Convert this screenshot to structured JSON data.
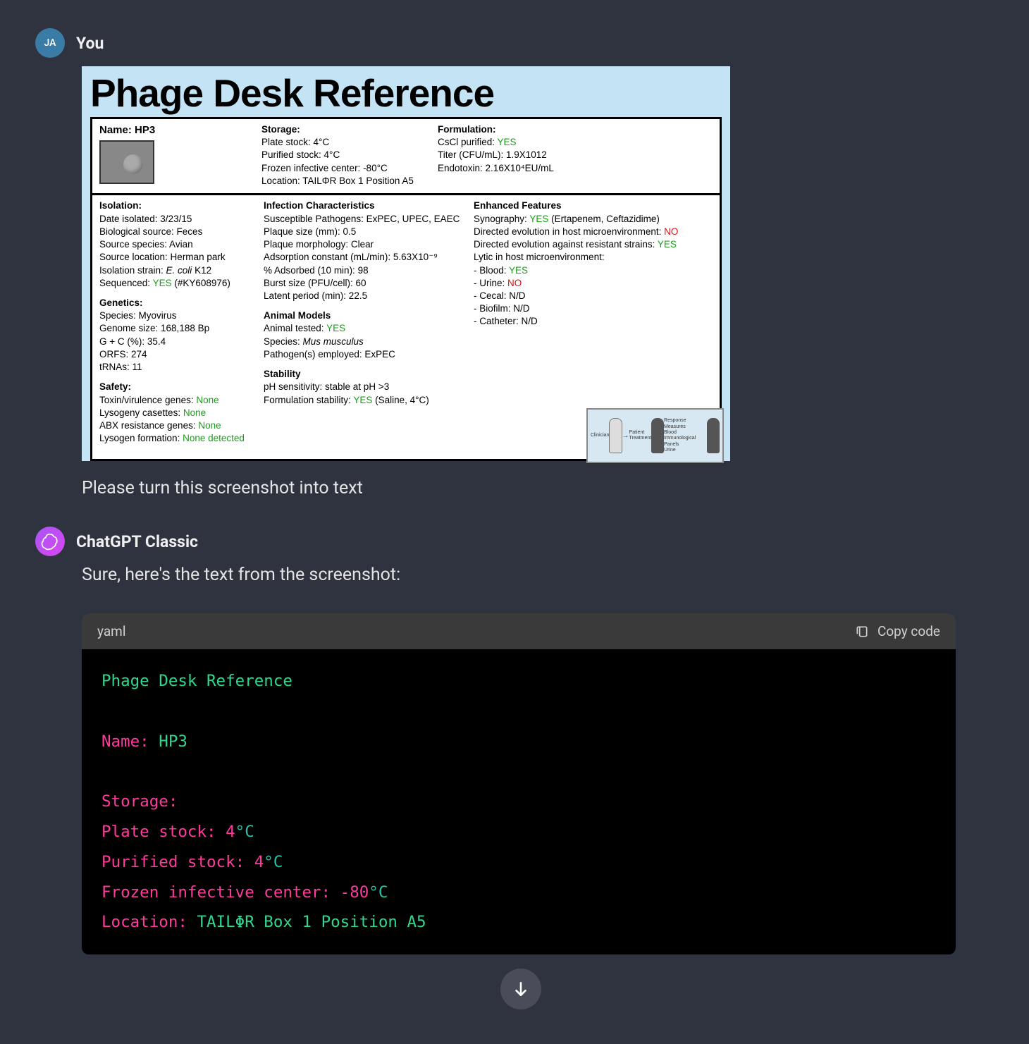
{
  "user": {
    "avatar_initials": "JA",
    "name": "You",
    "prompt": "Please turn this screenshot into text"
  },
  "bot": {
    "name": "ChatGPT Classic",
    "intro": "Sure, here's the text from the screenshot:"
  },
  "code": {
    "lang": "yaml",
    "copy_label": "Copy code",
    "lines": {
      "l1": "Phage Desk Reference",
      "l2_key": "Name:",
      "l2_val": " HP3",
      "l3": "Storage:",
      "l4_key": "Plate stock:",
      "l4_num": " 4",
      "l4_unit": "°C",
      "l5_key": "Purified stock:",
      "l5_num": " 4",
      "l5_unit": "°C",
      "l6_key": "Frozen infective center:",
      "l6_num": " -80",
      "l6_unit": "°C",
      "l7_key": "Location:",
      "l7_v1": " TAILΦR",
      "l7_v2": " Box",
      "l7_v3": " 1",
      "l7_v4": " Position",
      "l7_v5": " A5"
    }
  },
  "phage": {
    "title": "Phage Desk Reference",
    "name_label": "Name: HP3",
    "storage": {
      "title": "Storage:",
      "plate": "Plate stock: 4°C",
      "purified": "Purified stock: 4°C",
      "frozen": "Frozen infective center: -80°C",
      "location": "Location: TAILΦR Box 1 Position A5"
    },
    "formulation": {
      "title": "Formulation:",
      "cscl_label": "CsCl purified: ",
      "cscl_val": "YES",
      "titer": "Titer (CFU/mL): 1.9X1012",
      "endotoxin": "Endotoxin: 2.16X10⁴EU/mL"
    },
    "isolation": {
      "title": "Isolation:",
      "date": "Date isolated: 3/23/15",
      "bio": "Biological source: Feces",
      "species": "Source species: Avian",
      "loc": "Source location: Herman park",
      "strain_label": "Isolation strain: ",
      "strain_ital": "E. coli",
      "strain_rest": " K12",
      "seq_label": "Sequenced: ",
      "seq_val": "YES",
      "seq_rest": " (#KY608976)"
    },
    "genetics": {
      "title": "Genetics:",
      "species": "Species: Myovirus",
      "genome": "Genome size: 168,188 Bp",
      "gc": "G + C (%): 35.4",
      "orfs": "ORFS: 274",
      "trnas": "tRNAs: 11"
    },
    "safety": {
      "title": "Safety:",
      "toxin_label": "Toxin/virulence genes: ",
      "toxin_val": "None",
      "lyso_label": "Lysogeny casettes: ",
      "lyso_val": "None",
      "abx_label": "ABX resistance genes: ",
      "abx_val": "None",
      "lysof_label": "Lysogen formation: ",
      "lysof_val": "None detected"
    },
    "infection": {
      "title": "Infection Characteristics",
      "pathogens": "Susceptible Pathogens: ExPEC, UPEC, EAEC",
      "plaque_size": "Plaque size (mm): 0.5",
      "plaque_morph": "Plaque morphology: Clear",
      "adsorption": "Adsorption constant (mL/min): 5.63X10⁻⁹",
      "adsorbed": "% Adsorbed (10 min): 98",
      "burst": "Burst size (PFU/cell): 60",
      "latent": "Latent period (min): 22.5"
    },
    "animal": {
      "title": "Animal Models",
      "tested_label": "Animal tested: ",
      "tested_val": "YES",
      "species_label": "Species: ",
      "species_ital": "Mus musculus",
      "pathogens": "Pathogen(s) employed: ExPEC"
    },
    "stability": {
      "title": "Stability",
      "ph": "pH sensitivity: stable at pH >3",
      "form_label": "Formulation stability: ",
      "form_val": "YES",
      "form_rest": " (Saline, 4°C)"
    },
    "enhanced": {
      "title": "Enhanced Features",
      "syn_label": "Synography: ",
      "syn_val": "YES",
      "syn_rest": " (Ertapenem, Ceftazidime)",
      "de_host_label": "Directed evolution in host microenvironment: ",
      "de_host_val": "NO",
      "de_res_label": "Directed evolution against resistant strains: ",
      "de_res_val": "YES",
      "lytic_title": "Lytic in host microenvironment:",
      "blood_label": "- Blood: ",
      "blood_val": "YES",
      "urine_label": "- Urine: ",
      "urine_val": "NO",
      "cecal": "- Cecal: N/D",
      "biofilm": "- Biofilm: N/D",
      "catheter": "- Catheter: N/D"
    },
    "inset": {
      "clinician": "Clinician",
      "patient": "Patient",
      "response": "Response Measures",
      "blood": "Blood",
      "immuno": "Immunological Panels",
      "urine": "Urine",
      "treatment": "Treatment"
    }
  }
}
